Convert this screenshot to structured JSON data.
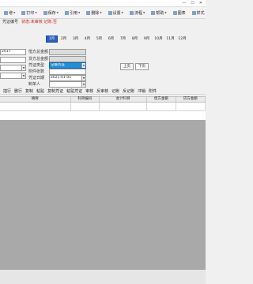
{
  "window": {
    "minimize": "—",
    "maximize": "☐",
    "close": "✕"
  },
  "toolbar": {
    "items": [
      {
        "label": "增",
        "icon": "add-icon",
        "dropdown": true
      },
      {
        "label": "打印",
        "icon": "print-icon",
        "dropdown": true
      },
      {
        "label": "保存",
        "icon": "save-icon",
        "dropdown": true
      },
      {
        "label": "引用",
        "icon": "quote-icon",
        "dropdown": true
      },
      {
        "label": "删除",
        "icon": "delete-icon",
        "dropdown": true
      },
      {
        "label": "设置",
        "icon": "settings-icon",
        "dropdown": true
      },
      {
        "label": "流程",
        "icon": "flow-icon",
        "dropdown": true
      },
      {
        "label": "帮助",
        "icon": "help-icon",
        "dropdown": true
      },
      {
        "label": "图表",
        "icon": "chart-icon",
        "dropdown": false
      },
      {
        "label": "样式",
        "icon": "style-icon",
        "dropdown": false
      }
    ]
  },
  "status_line": {
    "label": "凭证编号",
    "status_text": "状态:未审核 记账:否"
  },
  "months": {
    "items": [
      "1月",
      "2月",
      "3月",
      "4月",
      "5月",
      "6月",
      "7月",
      "8月",
      "9月",
      "10月",
      "11月",
      "12月"
    ],
    "active_index": 0
  },
  "form": {
    "left_top_value": "2017",
    "fields": [
      {
        "label": "借方总金额",
        "value": ""
      },
      {
        "label": "贷方总金额",
        "value": ""
      },
      {
        "label": "凭证类型",
        "value": "记账凭证"
      },
      {
        "label": "附件张数",
        "value": ""
      },
      {
        "label": "凭证日期",
        "value": "2021-01-05"
      },
      {
        "label": "制单人",
        "value": ""
      }
    ]
  },
  "pager": {
    "prev": "上页",
    "next": "下页"
  },
  "actions": {
    "items": [
      "插行",
      "删行",
      "复制",
      "粘贴",
      "复制凭证",
      "粘贴凭证",
      "审核",
      "反审核",
      "记账",
      "反记账",
      "冲销",
      "附件"
    ]
  },
  "grid": {
    "columns": [
      "摘要",
      "科目编码",
      "会计科目",
      "借方金额",
      "贷方金额"
    ]
  }
}
